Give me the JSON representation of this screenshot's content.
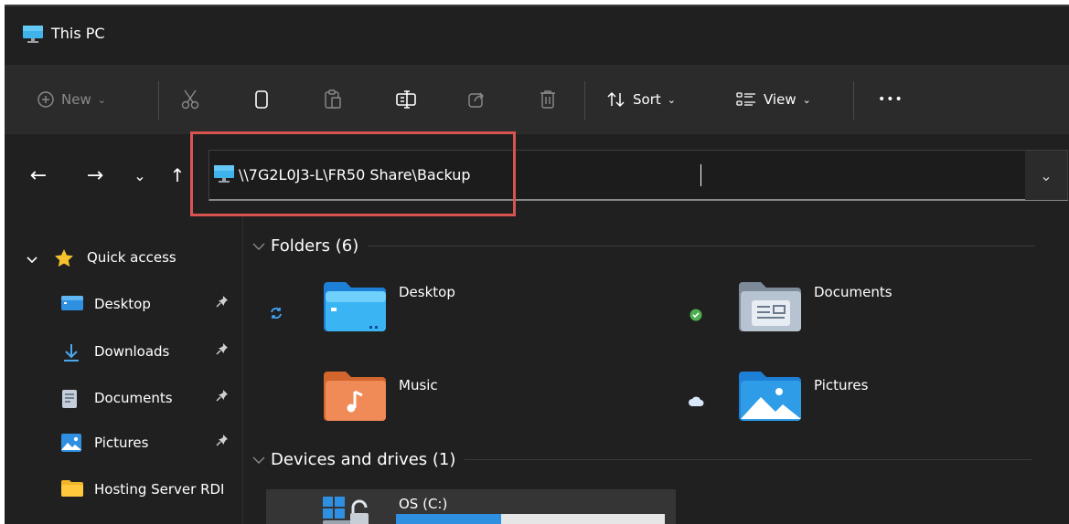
{
  "window": {
    "title": "This PC"
  },
  "toolbar": {
    "new_label": "New",
    "new_chevron": "⌄",
    "sort_label": "Sort",
    "sort_chevron": "⌄",
    "view_label": "View",
    "view_chevron": "⌄",
    "more_label": "•••",
    "icons": [
      "new-icon",
      "cut-icon",
      "copy-icon",
      "paste-icon",
      "rename-icon",
      "share-icon",
      "delete-icon",
      "sort-icon",
      "view-icon",
      "more-icon"
    ]
  },
  "nav": {
    "back": "←",
    "forward": "→",
    "recent": "⌄",
    "up": "↑",
    "address_value": "\\\\7G2L0J3-L\\FR50 Share\\Backup",
    "address_dropdown": "⌄"
  },
  "sidebar": {
    "quick_access_label": "Quick access",
    "items": [
      {
        "label": "Desktop",
        "icon": "desktop-folder-icon",
        "pinned": true
      },
      {
        "label": "Downloads",
        "icon": "download-icon",
        "pinned": true
      },
      {
        "label": "Documents",
        "icon": "documents-icon",
        "pinned": true
      },
      {
        "label": "Pictures",
        "icon": "pictures-icon",
        "pinned": true
      },
      {
        "label": "Hosting Server RDI",
        "icon": "folder-icon",
        "pinned": false
      }
    ]
  },
  "main": {
    "folders_header": "Folders (6)",
    "folders": [
      {
        "name": "Desktop",
        "status": "sync-icon"
      },
      {
        "name": "Documents",
        "status": "available-icon"
      },
      {
        "name": "Music",
        "status": ""
      },
      {
        "name": "Pictures",
        "status": "cloud-icon"
      }
    ],
    "devices_header": "Devices and drives (1)",
    "drive": {
      "name": "OS (C:)",
      "used_fraction": 0.39
    }
  },
  "colors": {
    "background": "#202020",
    "toolbar": "#2b2b2b",
    "highlight_box": "#d9534f",
    "accent": "#2f8fe0"
  }
}
